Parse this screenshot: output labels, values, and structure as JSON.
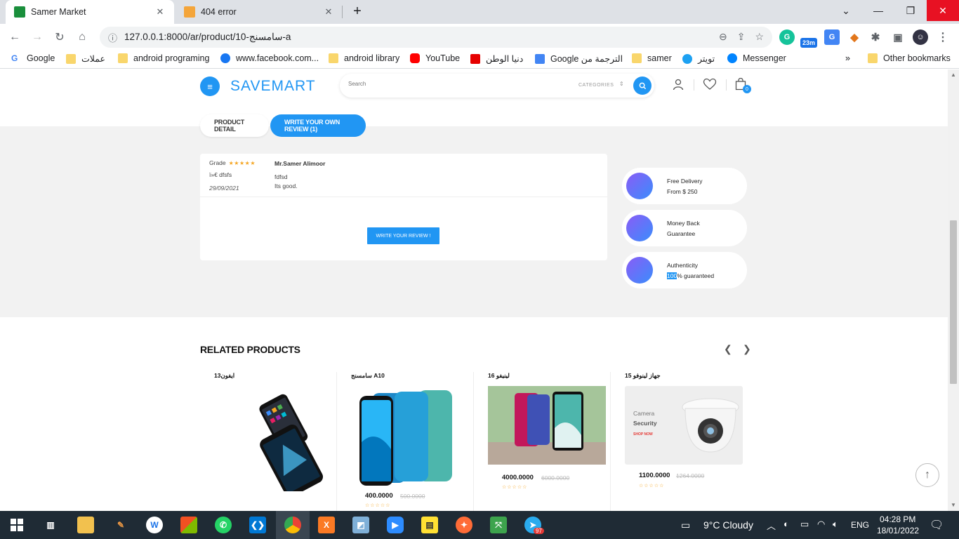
{
  "browser": {
    "tabs": [
      {
        "title": "Samer Market",
        "active": true
      },
      {
        "title": "404 error",
        "active": false
      }
    ],
    "url": "127.0.0.1:8000/ar/product/10-سامسنج-a",
    "ext_badge": "23m",
    "bookmarks": [
      "Google",
      "عملات",
      "android programing",
      "www.facebook.com...",
      "android library",
      "YouTube",
      "دنيا الوطن",
      "Google الترجمة من",
      "samer",
      "تويتر",
      "Messenger"
    ],
    "other_bookmarks": "Other bookmarks"
  },
  "site": {
    "logo": "SAVEMART",
    "search_placeholder": "Search",
    "categories_label": "CATEGORIES",
    "cart_count": "0"
  },
  "product_tabs": {
    "detail": "PRODUCT DETAIL",
    "review": "WRITE YOUR OWN REVIEW (1)"
  },
  "review": {
    "grade_label": "Grade",
    "stars": "★★★★★",
    "title": "ï»€ dfsfs",
    "date": "29/09/2021",
    "author": "Mr.Samer Alimoor",
    "headline": "fdfsd",
    "body": "Its good.",
    "write_button": "WRITE YOUR REVIEW !"
  },
  "features": [
    {
      "line1": "Free Delivery",
      "line2": "From $ 250"
    },
    {
      "line1": "Money Back",
      "line2": "Guarantee"
    },
    {
      "line1": "Authenticity",
      "line2_highlight": "100",
      "line2_rest": "% guaranteed"
    }
  ],
  "related": {
    "title": "RELATED PRODUCTS",
    "products": [
      {
        "name": "ايفون13",
        "price": "",
        "old_price": ""
      },
      {
        "name": "سامسنج A10",
        "price": "400.0000",
        "old_price": "500.0000"
      },
      {
        "name": "لينيفو 16",
        "price": "4000.0000",
        "old_price": "6000.0000"
      },
      {
        "name": "جهاز لينوفو 15",
        "price": "1100.0000",
        "old_price": "1264.0000"
      }
    ],
    "camera_ad": {
      "l1": "Camera",
      "l2": "Security",
      "l3": "SHOP NOW"
    }
  },
  "taskbar": {
    "weather": "9°C  Cloudy",
    "lang": "ENG",
    "time": "04:28 PM",
    "date": "18/01/2022",
    "telegram_badge": "97"
  }
}
